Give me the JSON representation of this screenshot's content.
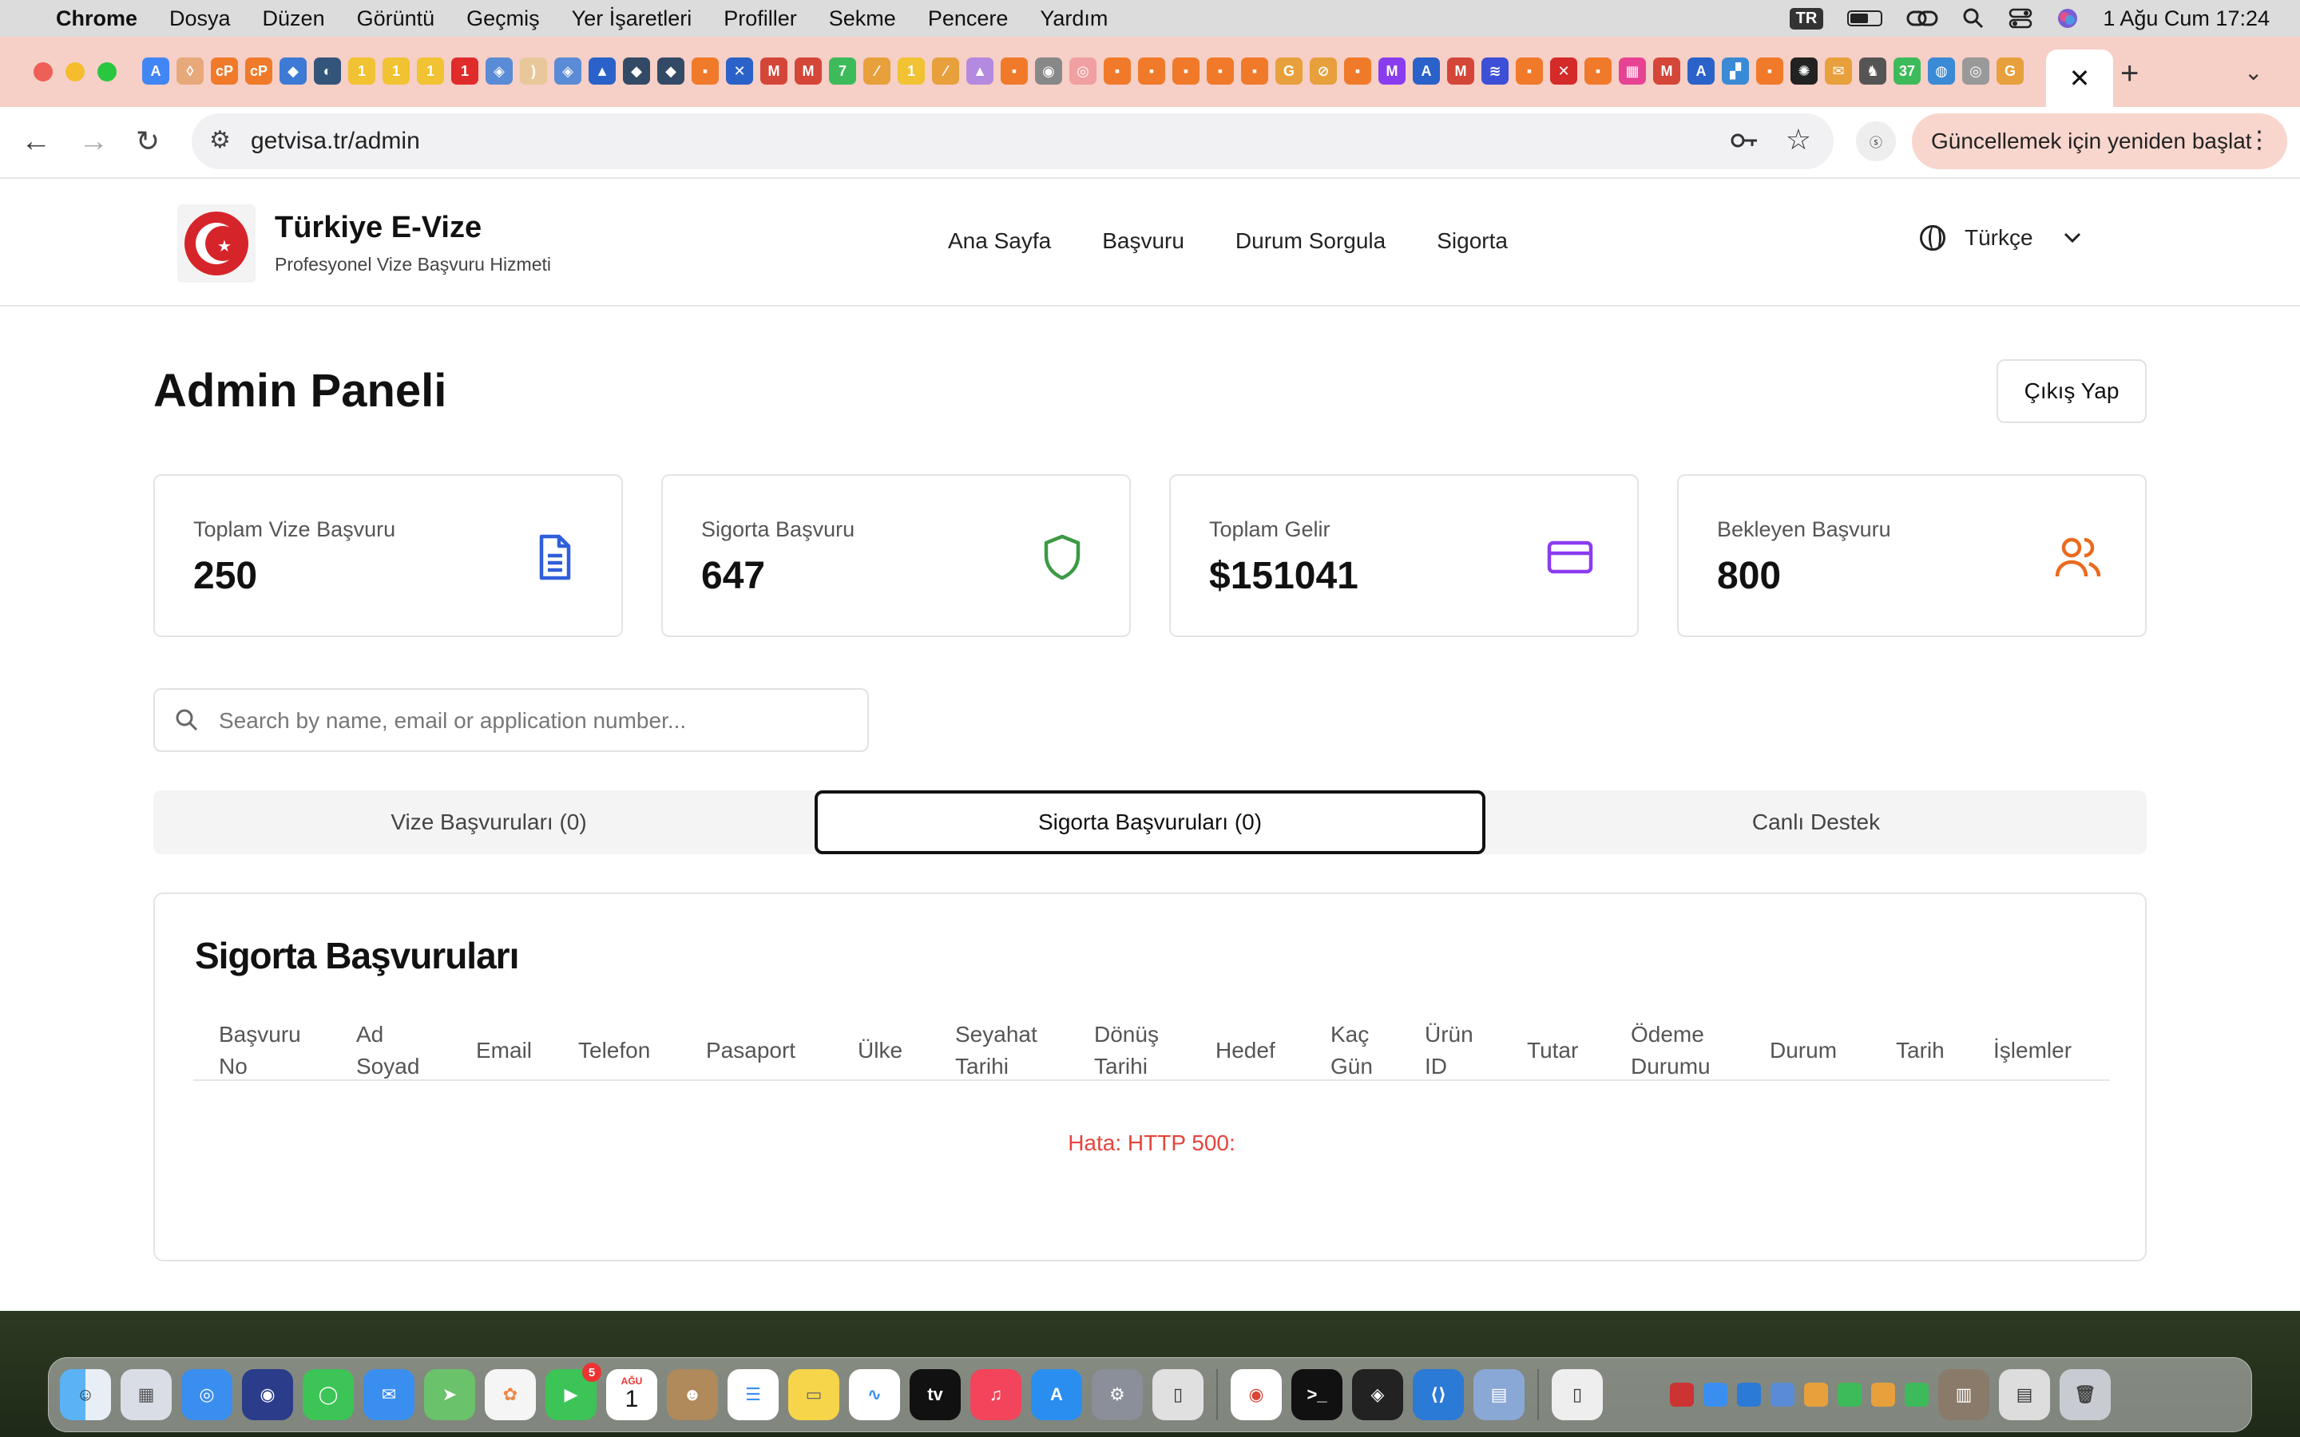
{
  "menubar": {
    "app": "Chrome",
    "items": [
      "Dosya",
      "Düzen",
      "Görüntü",
      "Geçmiş",
      "Yer İşaretleri",
      "Profiller",
      "Sekme",
      "Pencere",
      "Yardım"
    ],
    "input_source": "TR",
    "clock": "1 Ağu Cum  17:24"
  },
  "browser": {
    "url": "getvisa.tr/admin",
    "update_label": "Güncellemek için yeniden başlat"
  },
  "site": {
    "brand_title": "Türkiye E-Vize",
    "brand_subtitle": "Profesyonel Vize Başvuru Hizmeti",
    "nav": [
      "Ana Sayfa",
      "Başvuru",
      "Durum Sorgula",
      "Sigorta"
    ],
    "language": "Türkçe"
  },
  "admin": {
    "title": "Admin Paneli",
    "logout_label": "Çıkış Yap",
    "stats": [
      {
        "label": "Toplam Vize Başvuru",
        "value": "250",
        "icon": "document-icon",
        "color": "#2f5fd9"
      },
      {
        "label": "Sigorta Başvuru",
        "value": "647",
        "icon": "shield-icon",
        "color": "#3c9a45"
      },
      {
        "label": "Toplam Gelir",
        "value": "$151041",
        "icon": "credit-card-icon",
        "color": "#8a3cf0"
      },
      {
        "label": "Bekleyen Başvuru",
        "value": "800",
        "icon": "users-icon",
        "color": "#ea6a1f"
      }
    ],
    "search_placeholder": "Search by name, email or application number...",
    "tabs": [
      {
        "label": "Vize Başvuruları (0)",
        "active": false
      },
      {
        "label": "Sigorta Başvuruları (0)",
        "active": true
      },
      {
        "label": "Canlı Destek",
        "active": false
      }
    ],
    "panel_title": "Sigorta Başvuruları",
    "columns": [
      [
        "Başvuru",
        "No"
      ],
      [
        "Ad",
        "Soyad"
      ],
      [
        "Email"
      ],
      [
        "Telefon"
      ],
      [
        "Pasaport"
      ],
      [
        "Ülke"
      ],
      [
        "Seyahat",
        "Tarihi"
      ],
      [
        "Dönüş",
        "Tarihi"
      ],
      [
        "Hedef"
      ],
      [
        "Kaç",
        "Gün"
      ],
      [
        "Ürün",
        "ID"
      ],
      [
        "Tutar"
      ],
      [
        "Ödeme",
        "Durumu"
      ],
      [
        "Durum"
      ],
      [
        "Tarih"
      ],
      [
        "İşlemler"
      ]
    ],
    "error_text": "Hata: HTTP 500:"
  },
  "dock": {
    "calendar_month": "AĞU",
    "calendar_day": "1",
    "facetime_badge": "5"
  },
  "colors": {
    "accent": "#2f62ea",
    "error": "#e5443e",
    "tab_strip": "#f6cfc6"
  }
}
